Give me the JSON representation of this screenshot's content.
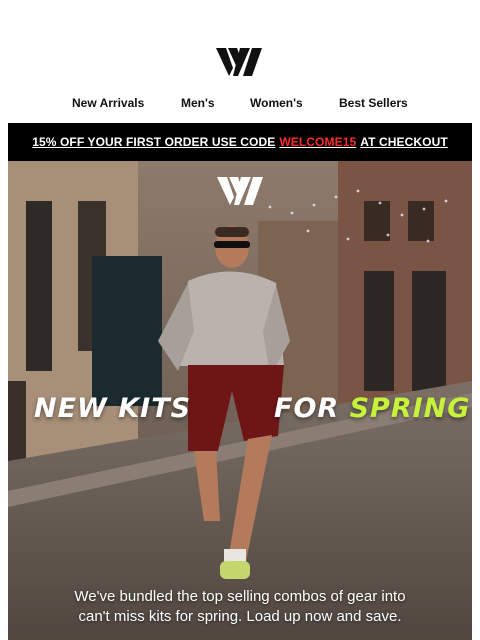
{
  "brand": {
    "logo_icon": "brand-vw-logo-icon",
    "logo_color": "#111111",
    "hero_logo_color": "#ffffff"
  },
  "nav": {
    "items": [
      {
        "label": "New Arrivals"
      },
      {
        "label": "Men's"
      },
      {
        "label": "Women's"
      },
      {
        "label": "Best Sellers"
      }
    ]
  },
  "promo": {
    "prefix": "15% OFF YOUR FIRST ORDER USE CODE",
    "code": "WELCOME15",
    "suffix": "AT CHECKOUT",
    "background": "#000000",
    "code_color": "#ff2a2a"
  },
  "hero": {
    "headline_left": "NEW KITS",
    "headline_right_prefix": "FOR",
    "headline_right_accent": "SPRING",
    "accent_color": "#c6f23b",
    "body_line1": "We've bundled the top selling combos of gear into",
    "body_line2": "can't miss kits for spring. Load up now and save."
  }
}
